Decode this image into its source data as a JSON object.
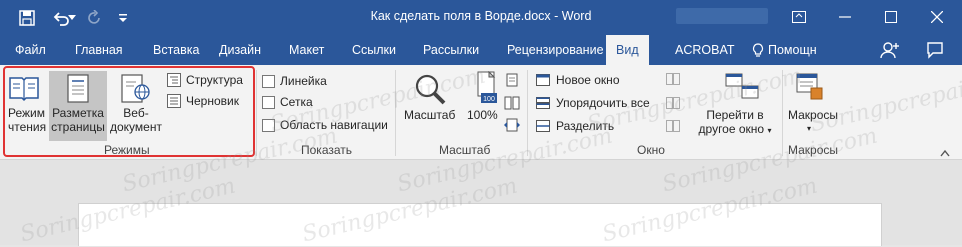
{
  "window": {
    "title": "Как сделать поля в Ворде.docx - Word"
  },
  "qat": {
    "icons": [
      "save-icon",
      "undo-icon",
      "undo-dropdown-icon",
      "redo-icon",
      "customize-icon"
    ]
  },
  "tabs": [
    {
      "label": "Файл"
    },
    {
      "label": "Главная"
    },
    {
      "label": "Вставка"
    },
    {
      "label": "Дизайн"
    },
    {
      "label": "Макет"
    },
    {
      "label": "Ссылки"
    },
    {
      "label": "Рассылки"
    },
    {
      "label": "Рецензирование"
    },
    {
      "label": "Вид",
      "active": true
    },
    {
      "label": "ACROBAT"
    },
    {
      "label": "Помощн"
    }
  ],
  "ribbon": {
    "modes": {
      "reading": [
        "Режим",
        "чтения"
      ],
      "layout": [
        "Разметка",
        "страницы"
      ],
      "web": [
        "Веб-",
        "документ"
      ],
      "outline": "Структура",
      "draft": "Черновик",
      "group": "Режимы"
    },
    "show": {
      "ruler": "Линейка",
      "grid": "Сетка",
      "nav": "Область навигации",
      "group": "Показать"
    },
    "zoom": {
      "zoom": "Масштаб",
      "percent": "100%",
      "group": "Масштаб"
    },
    "window": {
      "new_window": "Новое окно",
      "arrange_all": "Упорядочить все",
      "split": "Разделить",
      "switch": [
        "Перейти в",
        "другое окно"
      ],
      "group": "Окно"
    },
    "macros": {
      "label": "Макросы",
      "group": "Макросы"
    }
  },
  "watermark": "Soringpcrepair.com",
  "colors": {
    "accent": "#2b579a",
    "highlight": "#e03333",
    "ribbon_bg": "#f3f3f3"
  }
}
